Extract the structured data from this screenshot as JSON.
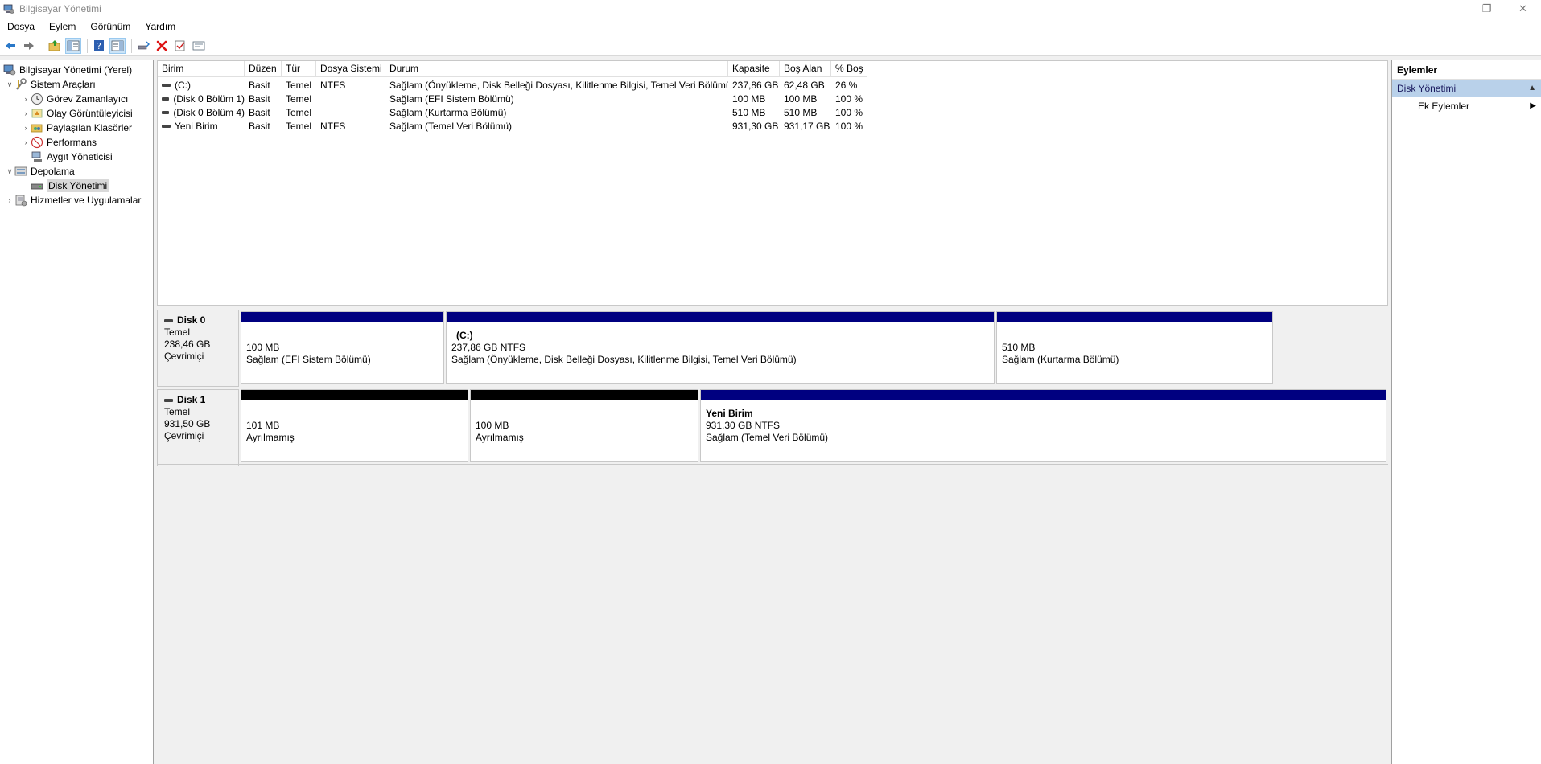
{
  "window": {
    "title": "Bilgisayar Yönetimi",
    "controls": [
      "minimize",
      "restore",
      "close"
    ]
  },
  "menu": [
    "Dosya",
    "Eylem",
    "Görünüm",
    "Yardım"
  ],
  "toolbar": {
    "buttons": [
      "back-arrow-icon",
      "forward-arrow-icon",
      "folder-up-icon",
      "show-hide-tree-icon",
      "help-icon",
      "show-hide-action-pane-icon",
      "connect-icon",
      "delete-icon",
      "properties-icon",
      "rescan-icon"
    ]
  },
  "tree": {
    "root": "Bilgisayar Yönetimi (Yerel)",
    "system_tools": "Sistem Araçları",
    "task_scheduler": "Görev Zamanlayıcı",
    "event_viewer": "Olay Görüntüleyicisi",
    "shared_folders": "Paylaşılan Klasörler",
    "performance": "Performans",
    "device_manager": "Aygıt Yöneticisi",
    "storage": "Depolama",
    "disk_management": "Disk Yönetimi",
    "services_apps": "Hizmetler ve Uygulamalar"
  },
  "volume_list": {
    "columns": [
      "Birim",
      "Düzen",
      "Tür",
      "Dosya Sistemi",
      "Durum",
      "Kapasite",
      "Boş Alan",
      "% Boş"
    ],
    "rows": [
      [
        "(C:)",
        "Basit",
        "Temel",
        "NTFS",
        "Sağlam (Önyükleme, Disk Belleği Dosyası, Kilitlenme Bilgisi, Temel Veri Bölümü)",
        "237,86 GB",
        "62,48 GB",
        "26 %"
      ],
      [
        "(Disk 0 Bölüm 1)",
        "Basit",
        "Temel",
        "",
        "Sağlam (EFI Sistem Bölümü)",
        "100 MB",
        "100 MB",
        "100 %"
      ],
      [
        "(Disk 0 Bölüm 4)",
        "Basit",
        "Temel",
        "",
        "Sağlam (Kurtarma Bölümü)",
        "510 MB",
        "510 MB",
        "100 %"
      ],
      [
        "Yeni Birim",
        "Basit",
        "Temel",
        "NTFS",
        "Sağlam (Temel Veri Bölümü)",
        "931,30 GB",
        "931,17 GB",
        "100 %"
      ]
    ]
  },
  "disks": [
    {
      "name": "Disk 0",
      "type": "Temel",
      "size": "238,46 GB",
      "status": "Çevrimiçi",
      "partitions": [
        {
          "name": "",
          "line1": "100 MB",
          "line2": "Sağlam (EFI Sistem Bölümü)",
          "bar": "blue"
        },
        {
          "name": "(C:)",
          "line1": "237,86 GB NTFS",
          "line2": "Sağlam (Önyükleme, Disk Belleği Dosyası, Kilitlenme Bilgisi, Temel Veri Bölümü)",
          "bar": "blue"
        },
        {
          "name": "",
          "line1": "510 MB",
          "line2": "Sağlam (Kurtarma Bölümü)",
          "bar": "blue"
        }
      ]
    },
    {
      "name": "Disk 1",
      "type": "Temel",
      "size": "931,50 GB",
      "status": "Çevrimiçi",
      "partitions": [
        {
          "name": "",
          "line1": "101 MB",
          "line2": "Ayrılmamış",
          "bar": "black"
        },
        {
          "name": "",
          "line1": "100 MB",
          "line2": "Ayrılmamış",
          "bar": "black"
        },
        {
          "name": "Yeni Birim",
          "line1": "931,30 GB NTFS",
          "line2": "Sağlam (Temel Veri Bölümü)",
          "bar": "blue"
        }
      ]
    }
  ],
  "actions": {
    "header": "Eylemler",
    "section": "Disk Yönetimi",
    "item": "Ek Eylemler"
  },
  "colors": {
    "partition_primary": "#000080",
    "partition_unallocated": "#000000",
    "actions_section_bg": "#b9d1ea"
  }
}
